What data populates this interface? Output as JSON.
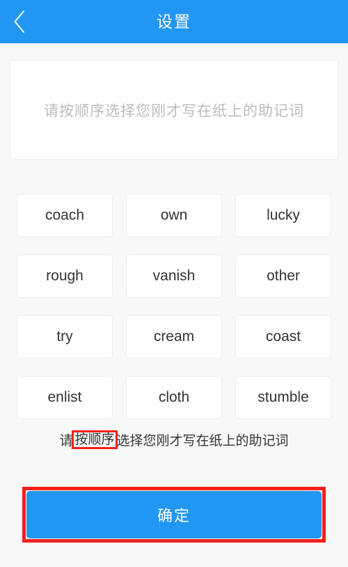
{
  "header": {
    "title": "设置",
    "back_icon": "chevron-left-icon",
    "background_color": "#2196f3",
    "text_color": "#ffffff"
  },
  "mnemonic_input": {
    "value": "",
    "placeholder": "请按顺序选择您刚才写在纸上的助记词"
  },
  "word_grid": {
    "words": [
      "coach",
      "own",
      "lucky",
      "rough",
      "vanish",
      "other",
      "try",
      "cream",
      "coast",
      "enlist",
      "cloth",
      "stumble"
    ]
  },
  "hint": {
    "prefix": "请",
    "highlight": "按顺序",
    "suffix": "选择您刚才写在纸上的助记词",
    "full_text": "请按顺序选择您刚才写在纸上的助记词",
    "highlight_color": "#f5201e"
  },
  "confirm": {
    "label": "确定",
    "background_color": "#2196f3",
    "annotation_color": "#f5201e"
  },
  "colors": {
    "page_background": "#f7f8f8",
    "card_background": "#ffffff",
    "accent": "#2196f3",
    "annotation": "#f5201e",
    "placeholder_text": "#b9bcbe",
    "body_text": "#333333"
  }
}
